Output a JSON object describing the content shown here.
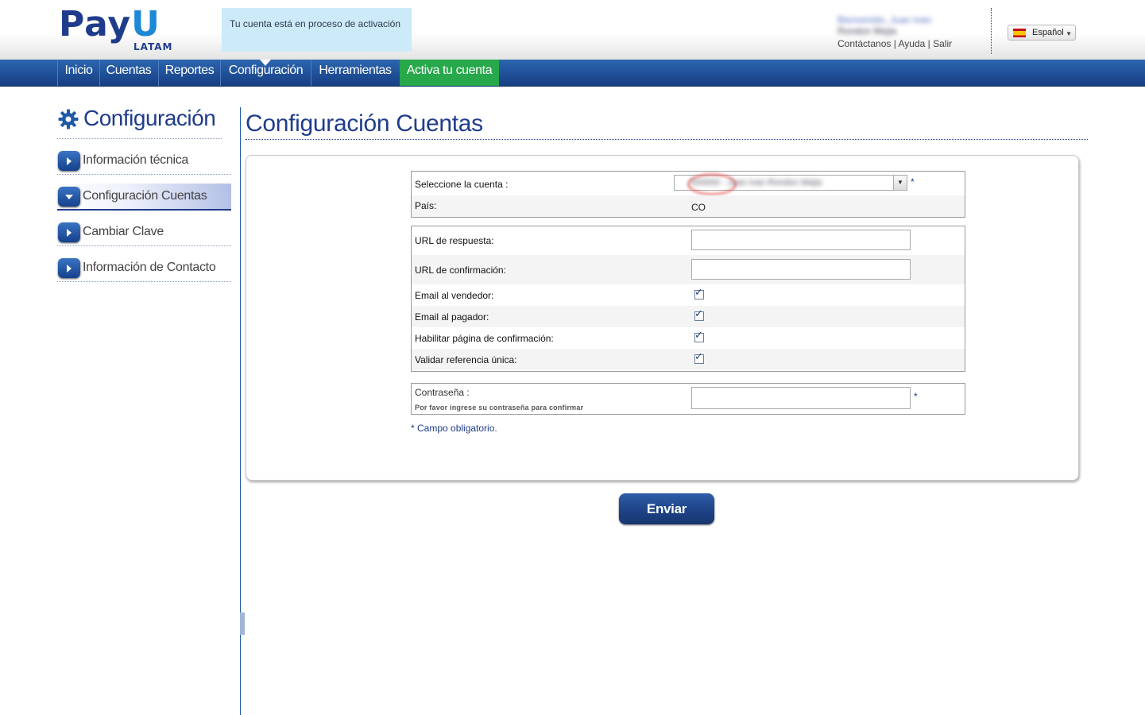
{
  "header": {
    "logo": {
      "main": "PayU",
      "sub": "LATAM"
    },
    "notice": "Tu cuenta está en proceso de activación",
    "user": {
      "greeting_blurred": "Bienvenido, Juan Ivan",
      "name_blurred": "Rondon Mejia",
      "links": [
        "Contáctanos",
        "Ayuda",
        "Salir"
      ]
    },
    "language": {
      "label": "Español",
      "flag": "spain-flag"
    }
  },
  "nav": {
    "items": [
      {
        "label": "Inicio"
      },
      {
        "label": "Cuentas"
      },
      {
        "label": "Reportes"
      },
      {
        "label": "Configuración",
        "active": true
      },
      {
        "label": "Herramientas"
      },
      {
        "label": "Activa tu cuenta",
        "highlight": "#27a84a"
      }
    ]
  },
  "sidebar": {
    "title": "Configuración",
    "items": [
      {
        "label": "Información técnica"
      },
      {
        "label": "Configuración Cuentas",
        "active": true
      },
      {
        "label": "Cambiar Clave"
      },
      {
        "label": "Información de Contacto"
      }
    ]
  },
  "main": {
    "title": "Configuración Cuentas",
    "account": {
      "select_label": "Seleccione la cuenta :",
      "select_value_blurred": "500000 - Juan Ivan Rondon Mejia",
      "required_mark": "*",
      "country_label": "País:",
      "country_value": "CO"
    },
    "urls": {
      "response_label": "URL de respuesta:",
      "response_value": "",
      "confirmation_label": "URL de confirmación:",
      "confirmation_value": ""
    },
    "options": [
      {
        "label": "Email al vendedor:",
        "checked": true
      },
      {
        "label": "Email al pagador:",
        "checked": true
      },
      {
        "label": "Habilitar página de confirmación:",
        "checked": true
      },
      {
        "label": "Validar referencia única:",
        "checked": true
      }
    ],
    "password": {
      "label": "Contraseña :",
      "hint": "Por favor ingrese su contraseña para confirmar",
      "required_mark": "*"
    },
    "required_note": "* Campo obligatorio.",
    "submit_label": "Enviar"
  },
  "colors": {
    "brand_blue": "#1f3c8c",
    "nav_blue": "#1e4e96",
    "activate_green": "#27a84a",
    "notice_bg": "#cdeaf8"
  }
}
